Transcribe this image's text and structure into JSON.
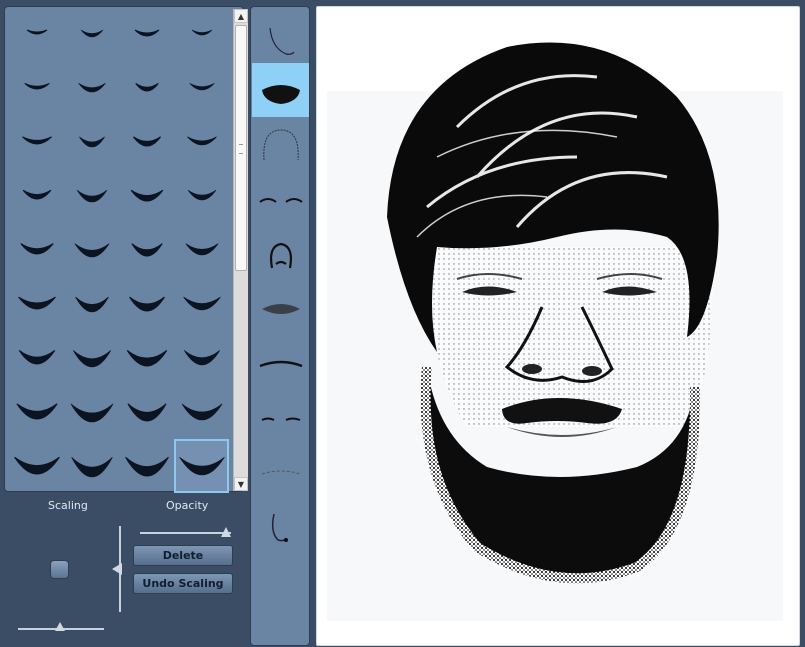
{
  "controls": {
    "scaling_label": "Scaling",
    "opacity_label": "Opacity",
    "delete_label": "Delete",
    "undo_label": "Undo Scaling"
  },
  "feature_grid": {
    "selected_index": 35,
    "item_count": 36
  },
  "categories": {
    "items": [
      "face-outline",
      "beard",
      "hair",
      "eyebrows",
      "nose",
      "mouth",
      "mustache",
      "eyes",
      "wrinkles",
      "ear"
    ],
    "selected": "beard"
  },
  "colors": {
    "panel": "#6a84a3",
    "background": "#3b4d64",
    "selected_category": "#8fd0f6",
    "selected_cell_outline": "#8fc8ef"
  }
}
